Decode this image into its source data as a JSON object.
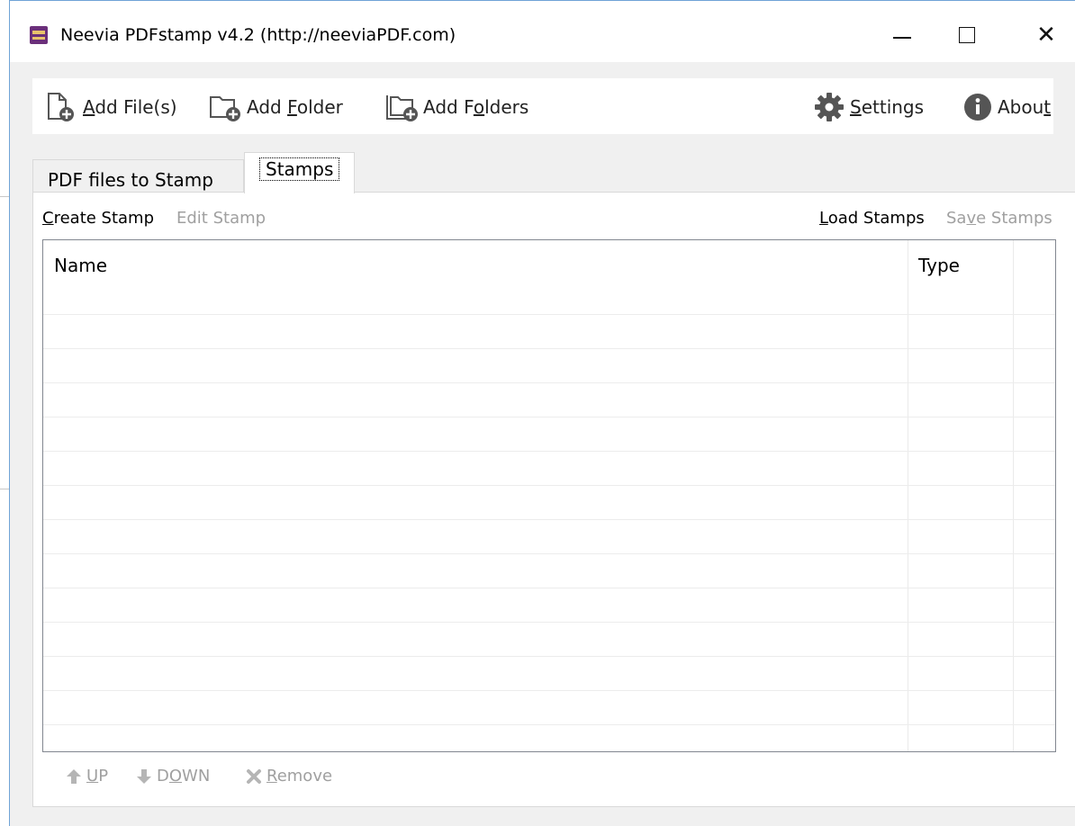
{
  "window": {
    "title": "Neevia PDFstamp v4.2 (http://neeviaPDF.com)",
    "minimize_icon": "minimize-icon",
    "maximize_icon": "maximize-icon",
    "close_glyph": "✕"
  },
  "toolbar": {
    "add_files": {
      "pre": "",
      "key": "A",
      "post": "dd File(s)"
    },
    "add_folder": {
      "pre": "Add ",
      "key": "F",
      "post": "older"
    },
    "add_folders": {
      "pre": "Add F",
      "key": "o",
      "post": "lders"
    },
    "settings": {
      "pre": "",
      "key": "S",
      "post": "ettings"
    },
    "about": {
      "pre": "Abou",
      "key": "t",
      "post": ""
    }
  },
  "tabs": [
    {
      "label": "PDF files to Stamp",
      "active": false
    },
    {
      "label": "Stamps",
      "active": true
    }
  ],
  "stamps_panel": {
    "create_stamp": {
      "key": "C",
      "post": "reate Stamp"
    },
    "edit_stamp": "Edit Stamp",
    "load_stamps": {
      "key": "L",
      "post": "oad Stamps"
    },
    "save_stamps": {
      "pre": "Sa",
      "key": "v",
      "post": "e Stamps"
    },
    "columns": [
      "Name",
      "Type"
    ],
    "rows": []
  },
  "bottom_bar": {
    "up": {
      "key": "U",
      "post": "P"
    },
    "down": {
      "pre": "D",
      "key": "O",
      "post": "WN"
    },
    "remove": {
      "key": "R",
      "post": "emove"
    }
  },
  "colors": {
    "accent_border": "#6fa3d6",
    "disabled_text": "#a0a0a0",
    "icon_gray": "#555555",
    "app_icon": "#6b2f7a"
  }
}
